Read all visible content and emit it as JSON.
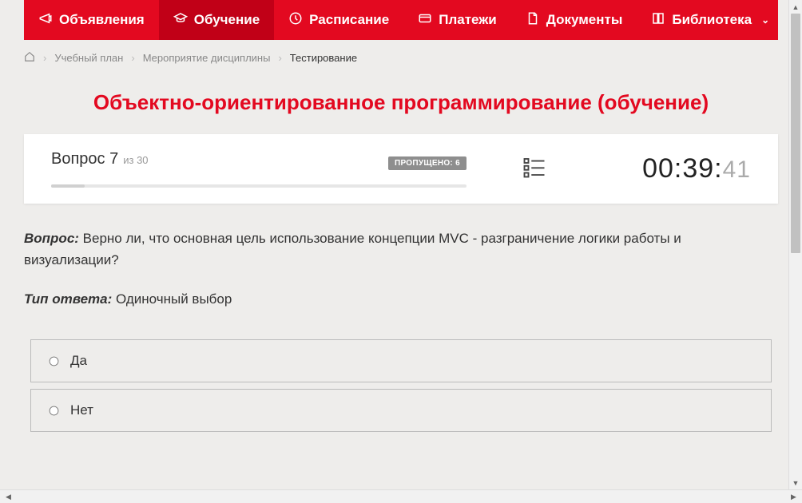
{
  "nav": {
    "items": [
      {
        "label": "Объявления",
        "icon": "megaphone"
      },
      {
        "label": "Обучение",
        "icon": "graduation"
      },
      {
        "label": "Расписание",
        "icon": "clock"
      },
      {
        "label": "Платежи",
        "icon": "card"
      },
      {
        "label": "Документы",
        "icon": "document"
      },
      {
        "label": "Библиотека",
        "icon": "book"
      }
    ]
  },
  "breadcrumb": {
    "items": [
      "Учебный план",
      "Мероприятие дисциплины"
    ],
    "current": "Тестирование"
  },
  "title": "Объектно-ориентированное программирование (обучение)",
  "question": {
    "label": "Вопрос 7",
    "of_prefix": "из",
    "of_total": "30",
    "skipped_label": "ПРОПУЩЕНО: 6",
    "skipped_count": 6,
    "current": 7,
    "total": 30
  },
  "timer": {
    "mm": "00",
    "ss": "39",
    "cs": "41"
  },
  "body": {
    "question_label": "Вопрос:",
    "question_text": "Верно ли, что основная цель использование концепции MVC - разграничение логики работы и визуализации?",
    "answer_type_label": "Тип ответа:",
    "answer_type": "Одиночный выбор"
  },
  "options": [
    {
      "label": "Да"
    },
    {
      "label": "Нет"
    }
  ]
}
